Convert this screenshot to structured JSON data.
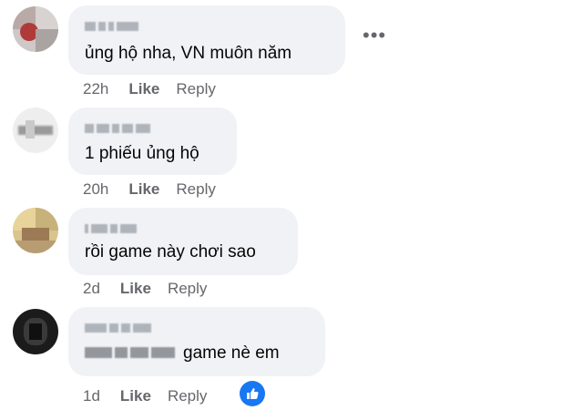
{
  "comments": [
    {
      "text": "ủng hộ nha, VN muôn năm",
      "time": "22h",
      "like": "Like",
      "reply": "Reply"
    },
    {
      "text": "1 phiếu ủng hộ",
      "time": "20h",
      "like": "Like",
      "reply": "Reply"
    },
    {
      "text": "rồi game này chơi sao",
      "time": "2d",
      "like": "Like",
      "reply": "Reply"
    },
    {
      "text": "game nè em",
      "time": "1d",
      "like": "Like",
      "reply": "Reply"
    }
  ],
  "icons": {
    "more": "more-options-icon",
    "reaction": "like-reaction-icon"
  },
  "colors": {
    "bubble": "#f0f2f5",
    "meta": "#65676b",
    "text": "#050505",
    "reaction": "#1877f2"
  }
}
